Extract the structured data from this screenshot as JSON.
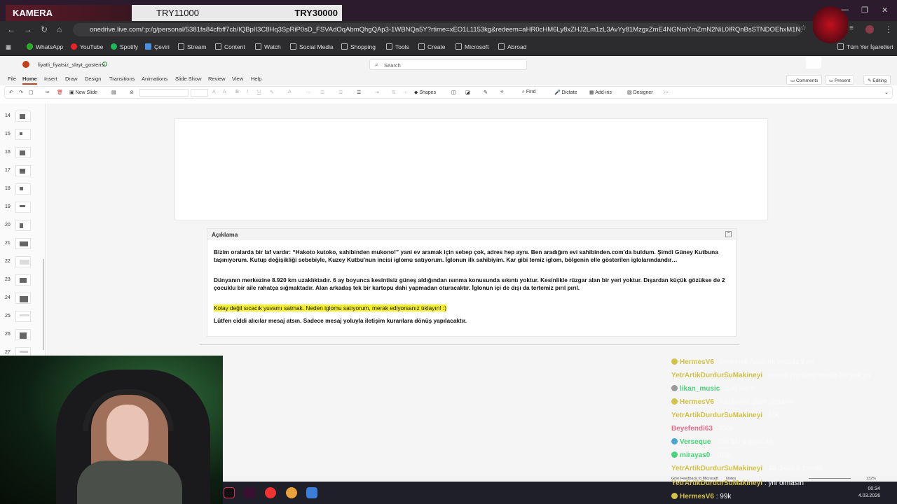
{
  "overlay": {
    "camera_label": "KAMERA",
    "price_left": "TRY11000",
    "price_right": "TRY30000"
  },
  "browser": {
    "url": "onedrive.live.com/:p:/g/personal/5381fa84cfbff7cb/IQBpII3C8Hq3SpRiP0sD_FSVAdOqAbmQhgQAp3-1WBNQa5Y?rtime=xEO1L1153kg&redeem=aHR0cHM6Ly8xZHJ2Lm1zL3AvYy81MzgxZmE4NGNmYmZmN2NiL0lRQnBsSTNDOEhxM1N...",
    "bookmarks": [
      {
        "label": "WhatsApp",
        "icon": "whatsapp-icon"
      },
      {
        "label": "YouTube",
        "icon": "youtube-icon"
      },
      {
        "label": "Spotify",
        "icon": "spotify-icon"
      },
      {
        "label": "Çeviri",
        "icon": "translate-icon"
      },
      {
        "label": "Stream",
        "icon": "folder-icon"
      },
      {
        "label": "Content",
        "icon": "folder-icon"
      },
      {
        "label": "Watch",
        "icon": "folder-icon"
      },
      {
        "label": "Social Media",
        "icon": "folder-icon"
      },
      {
        "label": "Shopping",
        "icon": "folder-icon"
      },
      {
        "label": "Tools",
        "icon": "folder-icon"
      },
      {
        "label": "Create",
        "icon": "folder-icon"
      },
      {
        "label": "Microsoft",
        "icon": "folder-icon"
      },
      {
        "label": "Abroad",
        "icon": "folder-icon"
      }
    ],
    "all_bookmarks": "Tüm Yer İşaretleri"
  },
  "app": {
    "doc_title": "fiyatli_fiyatsiz_slayt_gosterisi",
    "search_placeholder": "Search",
    "menu": [
      "File",
      "Home",
      "Insert",
      "Draw",
      "Design",
      "Transitions",
      "Animations",
      "Slide Show",
      "Review",
      "View",
      "Help"
    ],
    "active_menu": "Home",
    "right_buttons": {
      "comments": "Comments",
      "present": "Present",
      "editing": "Editing"
    },
    "ribbon": {
      "new_slide": "New Slide",
      "shapes": "Shapes",
      "find": "Find",
      "dictate": "Dictate",
      "addins": "Add-ins",
      "designer": "Designer"
    },
    "slide_numbers": [
      "14",
      "15",
      "16",
      "17",
      "18",
      "19",
      "20",
      "21",
      "22",
      "23",
      "24",
      "25",
      "26",
      "27"
    ],
    "notes": {
      "header": "Açıklama",
      "p1": "Bizim oralarda bir laf vardır: “Hakoto kutoko, sahibinden mukono!” yani ev aramak için sebep çok, adres hep aynı. Ben aradığım evi sahibinden.com'da buldum. Şimdi Güney Kutbuna taşınıyorum. Kutup değişikliği sebebiyle, Kuzey Kutbu'nun incisi iglomu satıyorum. İglonun ilk sahibiyim. Kar gibi temiz iglom, bölgenin elle gösterilen iglolarındandır…",
      "p2": "Dünyanın merkezine 8.920 km uzaklıktadır. 6 ay boyunca kesintisiz güneş aldığından ısınma konusunda sıkıntı yoktur. Kesinlikle rüzgar alan bir yeri yoktur. Dışardan küçük gözükse de 2 çocuklu bir aile rahatça sığmaktadır. Alan arkadaş tek bir kartopu dahi yapmadan oturacaktır. İglonun içi de dışı da tertemiz pırıl pırıl.",
      "p3": "Kolay değil sıcacık yuvamı satmak. Neden iglomu satıyorum, merak ediyorsanız tıklayın! :)",
      "p4": "Lütfen ciddi alıcılar mesaj atsın. Sadece mesaj yoluyla iletişim kuranlara dönüş yapılacaktır."
    },
    "status": {
      "feedback": "Give Feedback to Microsoft",
      "notes": "Notes",
      "zoom": "132%"
    }
  },
  "chat": [
    {
      "user": "HermesV6",
      "text": "çevirerek falan mı yazsaz tl mi",
      "badge": "#d2c14a"
    },
    {
      "user": "YetrArtikDurdurSuMakineyi",
      "text": "oranın piyasası bende hiç yok ya",
      "badge": ""
    },
    {
      "user": "likan_music",
      "text": "100 bin tl",
      "badge": "#9a9a9a"
    },
    {
      "user": "HermesV6",
      "text": "Karşısına gider yaparım",
      "badge": "#d2c14a"
    },
    {
      "user": "YetrArtikDurdurSuMakineyi",
      "text": "50k",
      "badge": ""
    },
    {
      "user": "Beyefendi63",
      "text": "799k",
      "badge": ""
    },
    {
      "user": "Verseque",
      "text": "650 Bin tl diyorum",
      "badge": "#4aa3d2"
    },
    {
      "user": "mirayas0",
      "text": "102k",
      "badge": "#4ad27a"
    },
    {
      "user": "YetrArtikDurdurSuMakineyi",
      "text": "48 diyim o zaman",
      "badge": ""
    },
    {
      "user": "YetrArtikDurdurSuMakineyi",
      "text": "yni olmasın",
      "badge": ""
    },
    {
      "user": "HermesV6",
      "text": "99k",
      "badge": "#d2c14a"
    }
  ],
  "clock": {
    "time": "00:34",
    "date": "4.03.2026"
  }
}
